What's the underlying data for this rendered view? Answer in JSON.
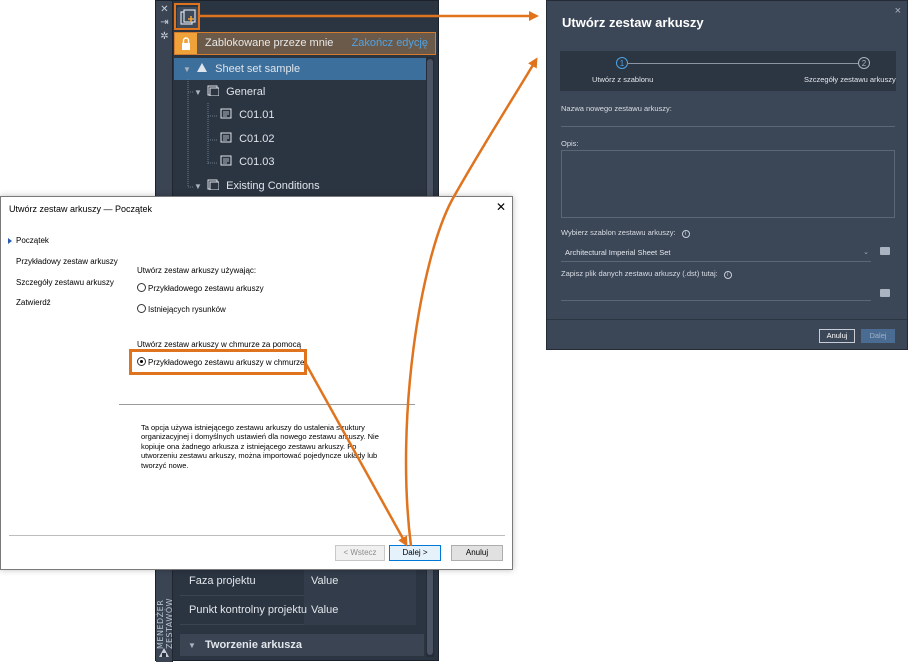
{
  "palette": {
    "locked_text": "Zablokowane przeze mnie",
    "finish_edit": "Zakończ edycję",
    "tree": [
      {
        "label": "Sheet set sample"
      },
      {
        "label": "General"
      },
      {
        "label": "C01.01"
      },
      {
        "label": "C01.02"
      },
      {
        "label": "C01.03"
      },
      {
        "label": "Existing Conditions"
      }
    ],
    "properties": [
      {
        "key": "Faza projektu",
        "value": "Value"
      },
      {
        "key": "Punkt kontrolny projektu",
        "value": "Value"
      }
    ],
    "section": "Tworzenie arkusza",
    "vertical_title": "MENEDŻER ZESTAWÓW"
  },
  "dialog_classic": {
    "title": "Utwórz zestaw arkuszy — Początek",
    "nav": [
      "Początek",
      "Przykładowy zestaw arkuszy",
      "Szczegóły zestawu arkuszy",
      "Zatwierdź"
    ],
    "group1_label": "Utwórz zestaw arkuszy używając:",
    "opt1": "Przykładowego zestawu arkuszy",
    "opt2": "Istniejących rysunków",
    "group2_label": "Utwórz zestaw arkuszy w chmurze za pomocą",
    "opt3": "Przykładowego zestawu arkuszy w chmurze",
    "description": "Ta opcja używa istniejącego zestawu arkuszy do ustalenia struktury organizacyjnej i domyślnych ustawień dla nowego zestawu arkuszy. Nie kopiuje ona żadnego arkusza z istniejącego zestawu arkuszy. Po utworzeniu zestawu arkuszy, można importować pojedyncze układy lub tworzyć nowe.",
    "btn_back": "< Wstecz",
    "btn_next": "Dalej >",
    "btn_cancel": "Anuluj"
  },
  "dialog_modern": {
    "title": "Utwórz zestaw arkuszy",
    "close": "×",
    "step1_num": "1",
    "step1_label": "Utwórz z szablonu",
    "step2_num": "2",
    "step2_label": "Szczegóły zestawu arkuszy",
    "name_label": "Nazwa nowego zestawu arkuszy:",
    "desc_label": "Opis:",
    "template_label": "Wybierz szablon zestawu arkuszy:",
    "template_value": "Architectural Imperial Sheet Set",
    "save_label": "Zapisz plik danych zestawu arkuszy (.dst) tutaj:",
    "btn_cancel": "Anuluj",
    "btn_next": "Dalej"
  },
  "colors": {
    "accent_orange": "#e0741e",
    "dark_bg": "#2b3441",
    "link_blue": "#4ea3e8"
  }
}
